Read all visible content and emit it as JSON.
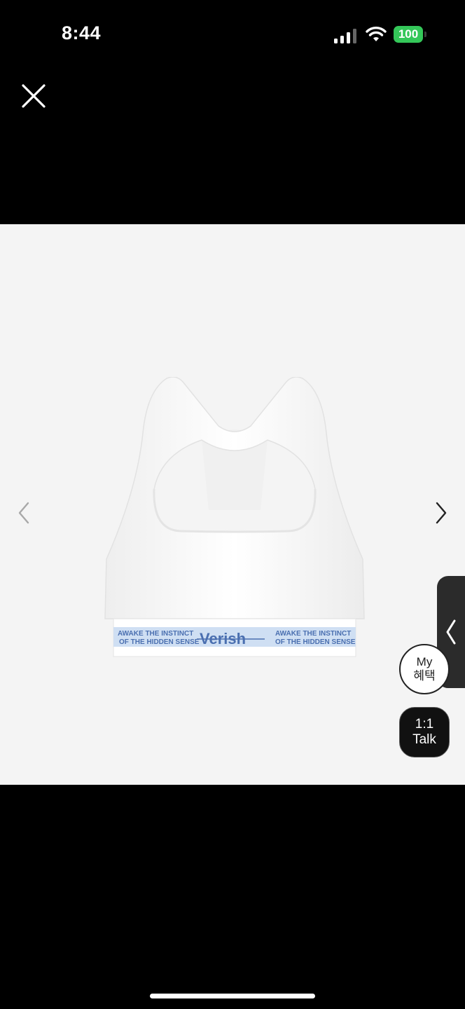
{
  "status_bar": {
    "time": "8:44",
    "battery": "100",
    "icons": [
      "signal-icon",
      "wifi-icon",
      "battery-icon"
    ]
  },
  "viewer": {
    "close_icon": "close-icon",
    "prev_icon": "chevron-left-icon",
    "next_icon": "chevron-right-icon",
    "product": {
      "band_text_line1": "AWAKE THE INSTINCT",
      "band_text_line2": "OF THE HIDDEN SENSE",
      "brand_logo": "Verish"
    }
  },
  "floating": {
    "side_tab_icon": "chevron-left-icon",
    "my_benefits": {
      "line1": "My",
      "line2": "혜택"
    },
    "talk": {
      "line1": "1:1",
      "line2": "Talk"
    }
  },
  "colors": {
    "background": "#000000",
    "viewer_bg": "#f4f4f4",
    "battery": "#34c759",
    "band": "#cfdff3",
    "band_text": "#4a6fb0"
  }
}
